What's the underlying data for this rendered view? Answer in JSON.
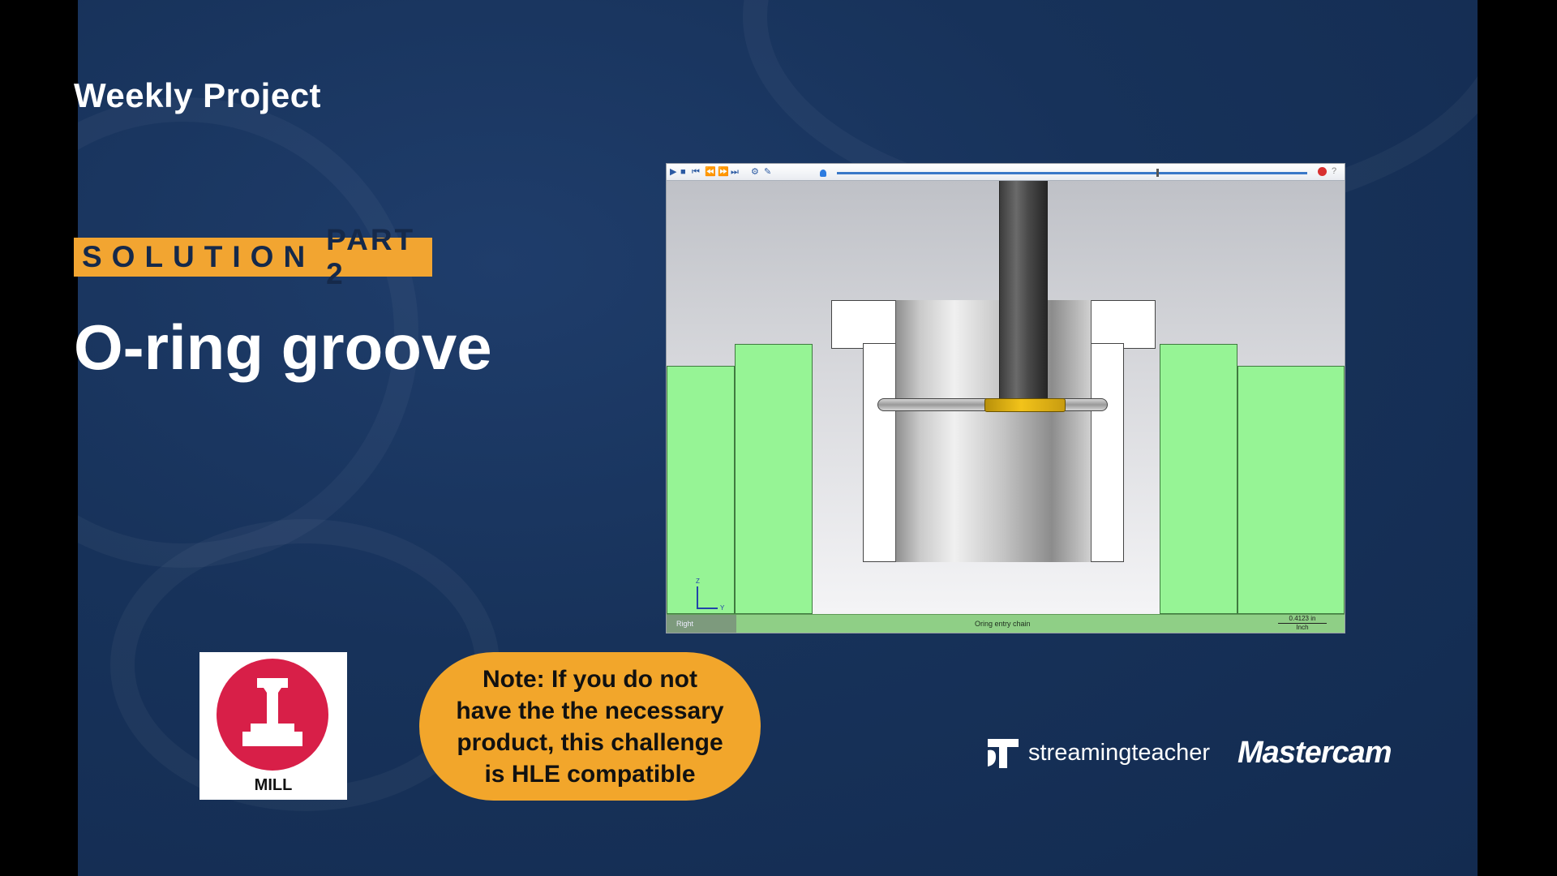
{
  "slide": {
    "eyebrow": "Weekly Project",
    "banner_word1": "SOLUTION",
    "banner_word2": "PART 2",
    "title": "O-ring groove"
  },
  "simulator": {
    "toolbar": {
      "buttons": [
        "play-icon",
        "stop-icon",
        "skip-start-icon",
        "step-back-icon",
        "step-forward-icon",
        "skip-end-icon",
        "options-icon",
        "edit-icon"
      ],
      "progress": 0.68
    },
    "status": {
      "view": "Right",
      "operation": "Oring entry chain",
      "scale_value": "0.4123 in",
      "scale_unit": "Inch"
    },
    "axes": {
      "z": "Z",
      "y": "Y"
    }
  },
  "mill_badge": {
    "label": "MILL",
    "icon": "mill-tool-icon",
    "color": "#d81f48"
  },
  "note": {
    "text": "Note: If you do not have the the necessary product, this challenge is HLE compatible"
  },
  "brands": {
    "streamingteacher": "streamingteacher",
    "mastercam": "Mastercam"
  },
  "colors": {
    "background": "#17325a",
    "accent": "#f2a531",
    "stock": "#96f495"
  }
}
